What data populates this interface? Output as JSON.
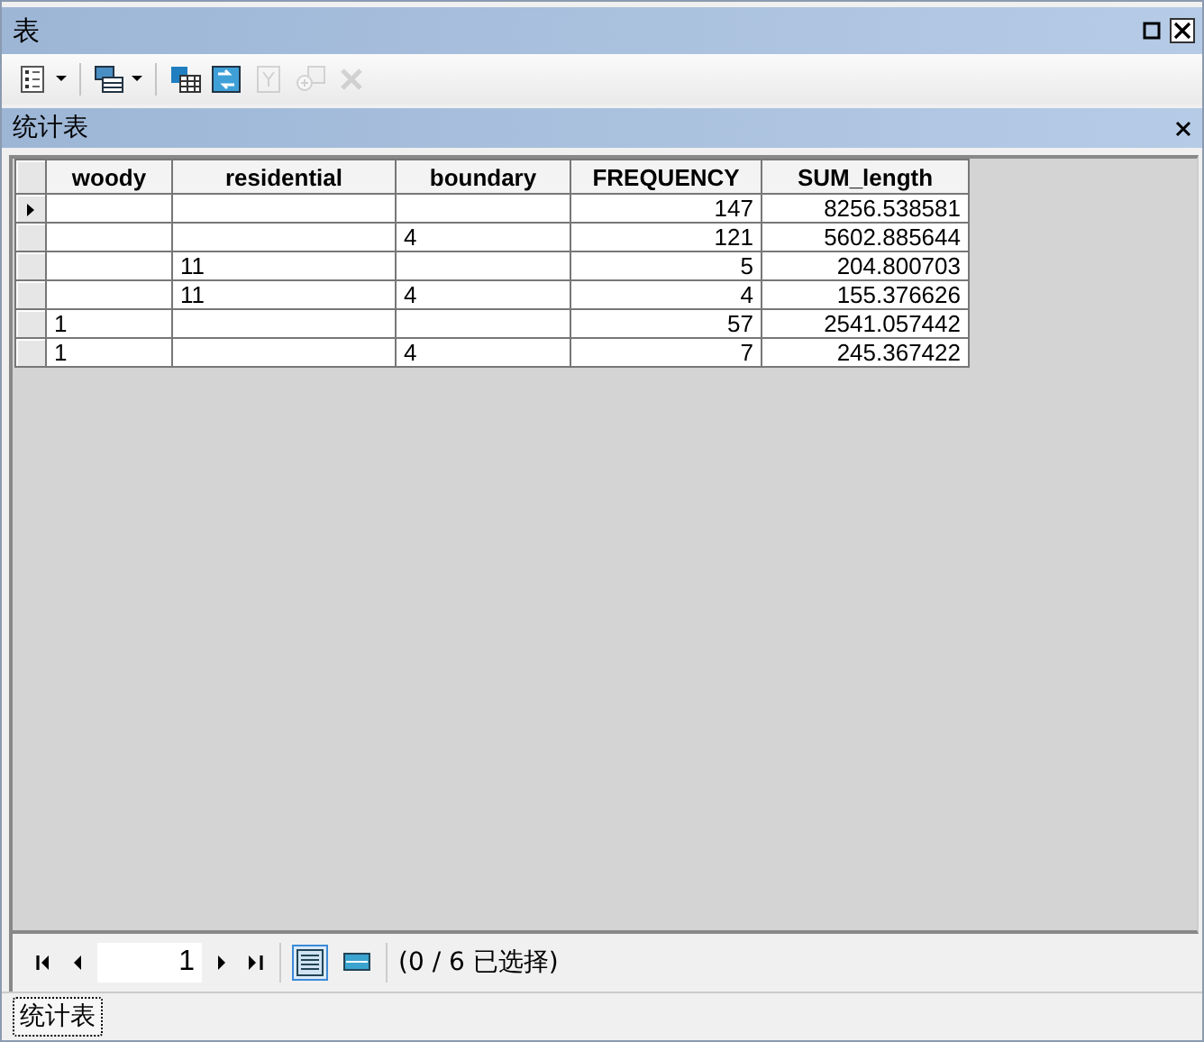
{
  "window": {
    "title": "表"
  },
  "toolbar": [
    {
      "kind": "list",
      "dropdown": true,
      "disabled": false
    },
    {
      "kind": "relate",
      "dropdown": true,
      "disabled": false
    },
    {
      "kind": "select",
      "dropdown": false,
      "disabled": false
    },
    {
      "kind": "switch",
      "dropdown": false,
      "disabled": false
    },
    {
      "kind": "clear",
      "dropdown": false,
      "disabled": true
    },
    {
      "kind": "zoom",
      "dropdown": false,
      "disabled": true
    },
    {
      "kind": "delete",
      "dropdown": false,
      "disabled": true
    }
  ],
  "panel": {
    "title": "统计表"
  },
  "table": {
    "columns": [
      "woody",
      "residential",
      "boundary",
      "FREQUENCY",
      "SUM_length"
    ],
    "rows": [
      {
        "current": true,
        "cells": [
          "",
          "",
          "",
          "147",
          "8256.538581"
        ]
      },
      {
        "current": false,
        "cells": [
          "",
          "",
          "4",
          "121",
          "5602.885644"
        ]
      },
      {
        "current": false,
        "cells": [
          "",
          "11",
          "",
          "5",
          "204.800703"
        ]
      },
      {
        "current": false,
        "cells": [
          "",
          "11",
          "4",
          "4",
          "155.376626"
        ]
      },
      {
        "current": false,
        "cells": [
          "1",
          "",
          "",
          "57",
          "2541.057442"
        ]
      },
      {
        "current": false,
        "cells": [
          "1",
          "",
          "4",
          "7",
          "245.367422"
        ]
      }
    ]
  },
  "navigator": {
    "record": "1",
    "views": [
      {
        "kind": "all",
        "selected": true
      },
      {
        "kind": "selected",
        "selected": false
      }
    ],
    "status": "(0 / 6 已选择)"
  },
  "tabs": [
    {
      "label": "统计表",
      "selected": true
    }
  ]
}
